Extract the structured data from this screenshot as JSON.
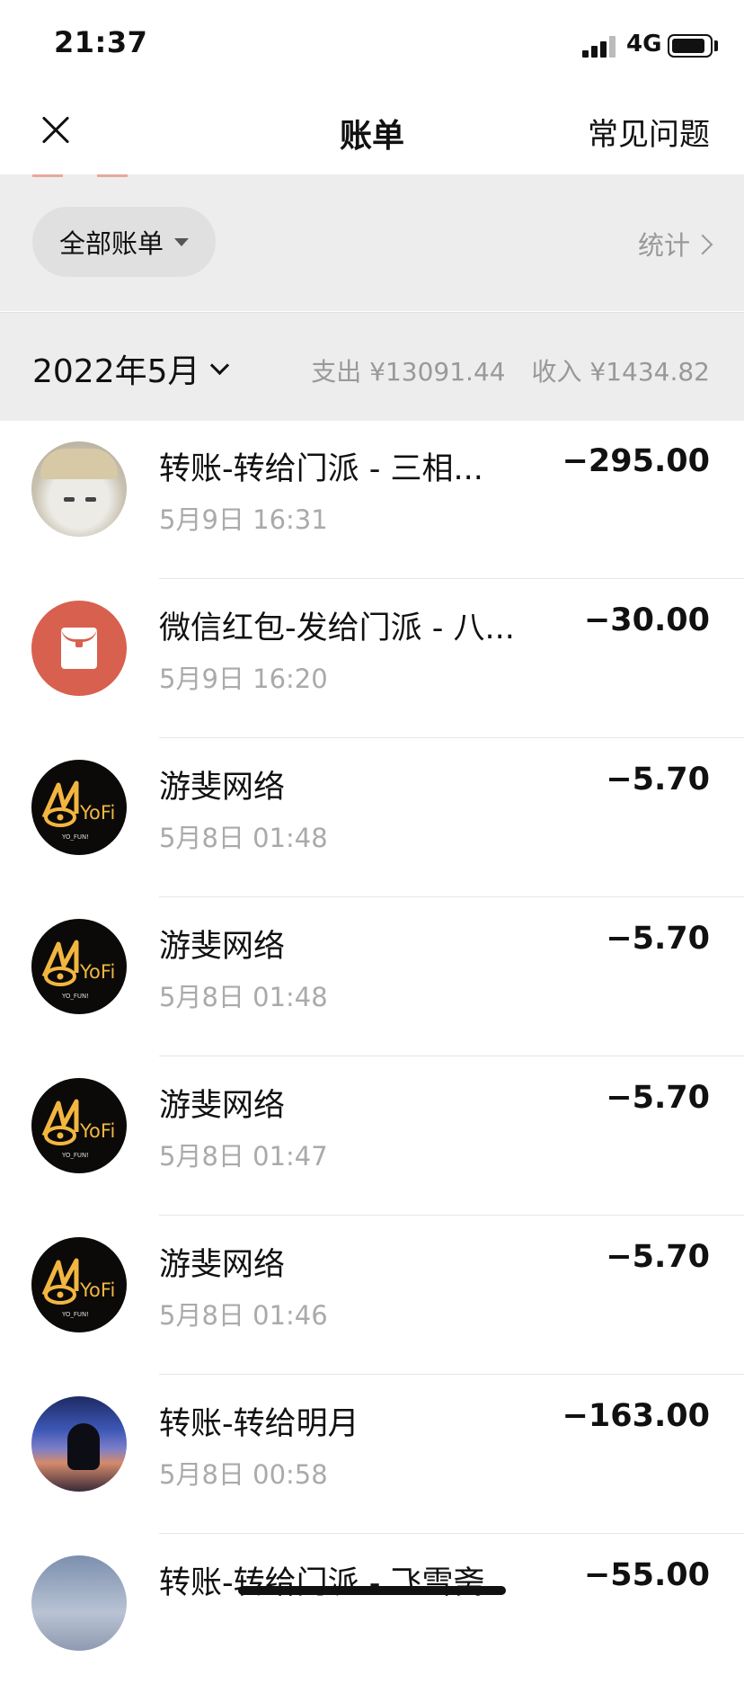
{
  "status_bar": {
    "time": "21:37",
    "network": "4G"
  },
  "nav": {
    "title": "账单",
    "faq": "常见问题"
  },
  "filter": {
    "pill_label": "全部账单",
    "stats_label": "统计"
  },
  "month": {
    "label": "2022年5月",
    "expense": "支出 ¥13091.44",
    "income": "收入 ¥1434.82"
  },
  "transactions": [
    {
      "title": "转账-转给门派 - 三相...",
      "time": "5月9日 16:31",
      "amount": "−295.00",
      "avatar": "ghost-avatar"
    },
    {
      "title": "微信红包-发给门派 - 八...",
      "time": "5月9日 16:20",
      "amount": "−30.00",
      "avatar": "red-packet-icon"
    },
    {
      "title": "游斐网络",
      "time": "5月8日 01:48",
      "amount": "−5.70",
      "avatar": "yofi-logo"
    },
    {
      "title": "游斐网络",
      "time": "5月8日 01:48",
      "amount": "−5.70",
      "avatar": "yofi-logo"
    },
    {
      "title": "游斐网络",
      "time": "5月8日 01:47",
      "amount": "−5.70",
      "avatar": "yofi-logo"
    },
    {
      "title": "游斐网络",
      "time": "5月8日 01:46",
      "amount": "−5.70",
      "avatar": "yofi-logo"
    },
    {
      "title": "转账-转给明月",
      "time": "5月8日 00:58",
      "amount": "−163.00",
      "avatar": "sunset-avatar"
    },
    {
      "title": "转账-转给门派 - 飞雪斋",
      "time": "",
      "amount": "−55.00",
      "avatar": "sky-avatar"
    }
  ],
  "logo_text": {
    "yofi": "YoFi",
    "yofi_sub": "YO_FUN!"
  }
}
